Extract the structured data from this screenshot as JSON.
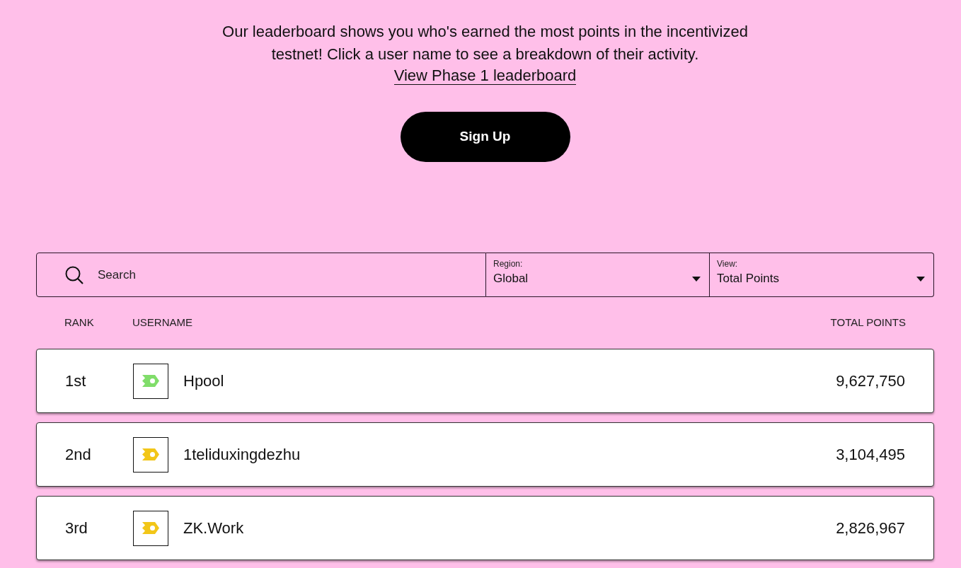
{
  "intro": {
    "text": "Our leaderboard shows you who's earned the most points in the incentivized testnet! Click a user name to see a breakdown of their activity.",
    "link": "View Phase 1 leaderboard"
  },
  "signup_button": "Sign Up",
  "filters": {
    "search": {
      "placeholder": "Search"
    },
    "dropdowns": [
      {
        "label": "Region:",
        "value": "Global"
      },
      {
        "label": "View:",
        "value": "Total Points"
      }
    ]
  },
  "table": {
    "columns": [
      "RANK",
      "USERNAME",
      "TOTAL POINTS"
    ],
    "rows": [
      {
        "rank": "1st",
        "username": "Hpool",
        "points": "9,627,750",
        "color": "#80dd6a"
      },
      {
        "rank": "2nd",
        "username": "1teliduxingdezhu",
        "points": "3,104,495",
        "color": "#f2c618"
      },
      {
        "rank": "3rd",
        "username": "ZK.Work",
        "points": "2,826,967",
        "color": "#f2c618"
      }
    ]
  }
}
